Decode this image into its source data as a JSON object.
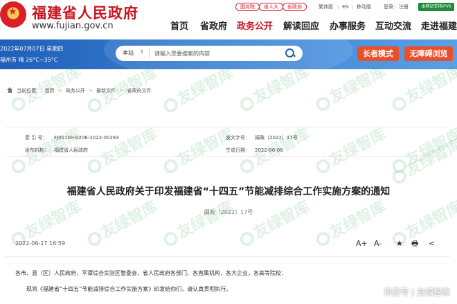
{
  "site": {
    "name": "福建省人民政府",
    "url": "www.fujian.gov.cn"
  },
  "top_links": {
    "pill_1": "国务院",
    "pill_2": "省人大",
    "pill_3": "省政协",
    "traditional": "繁体版",
    "english": "EN",
    "mobile": "移动版",
    "login": "登录",
    "register": "注册",
    "ipv6": "本网站支持IPV6"
  },
  "nav": {
    "items": [
      "首页",
      "省政府",
      "政务公开",
      "解读回应",
      "办事服务",
      "互动交流",
      "走进福建"
    ],
    "active_index": 2
  },
  "banner": {
    "date": "2022年07月07日 星期四",
    "weather": "福州市 晴 26°C~35°C",
    "search_scope": "本站",
    "search_placeholder": "请输入您要搜索的内容",
    "elder_mode": "长者模式",
    "accessible": "无障碍浏览"
  },
  "breadcrumb": {
    "prefix": "当前位置：",
    "items": [
      "首页",
      "政务公开",
      "最新文件",
      "省政府文件"
    ],
    "separator": ">"
  },
  "meta": {
    "index_label": "索 引 号：",
    "index_value": "FJ00100-0206-2022-00283",
    "publisher_label": "发布机构：",
    "publisher_value": "福建省人民政府",
    "docno_label": "发文字号：",
    "docno_value": "闽政〔2022〕17号",
    "date_label": "生成日期：",
    "date_value": "2022-06-08"
  },
  "article": {
    "title": "福建省人民政府关于印发福建省“十四五”节能减排综合工作实施方案的通知",
    "doc_number": "闽政〔2022〕17号",
    "publish_time": "2022-06-17 16:59",
    "tools": [
      "A+",
      "A-",
      "★",
      "🖶",
      "<"
    ],
    "paragraph_1": "各市、县（区）人民政府，平潭综合实验区管委会，省人民政府各部门、各直属机构，各大企业，各高等院校：",
    "paragraph_2": "现将《福建省“十四五”节能减排综合工作实施方案》印发给你们，请认真贯彻执行。"
  },
  "watermark": {
    "text": "友绿智库",
    "footer": "风景号 | 友绿智库"
  },
  "colors": {
    "brand_red": "#c9151e",
    "banner_blue": "#1f5fb8",
    "accent_orange": "#e8502c",
    "watermark_green": "#3aa860"
  }
}
